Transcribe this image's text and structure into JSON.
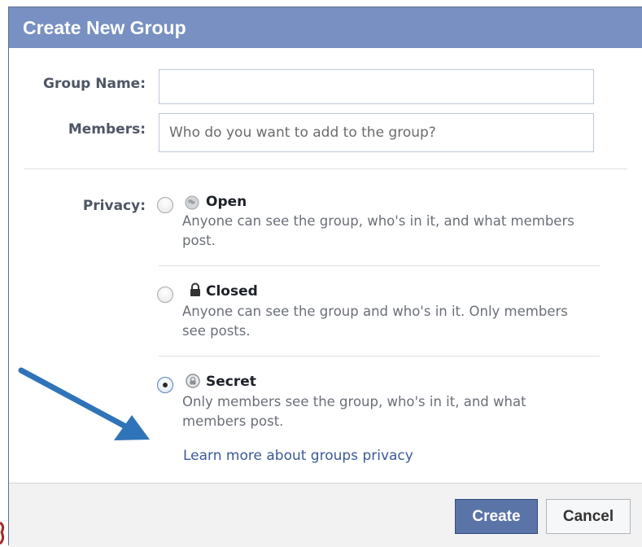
{
  "dialog": {
    "title": "Create New Group",
    "group_name_label": "Group Name:",
    "group_name_value": "",
    "members_label": "Members:",
    "members_placeholder": "Who do you want to add to the group?",
    "privacy_label": "Privacy:",
    "options": [
      {
        "title": "Open",
        "desc": "Anyone can see the group, who's in it, and what members post.",
        "icon": "globe-icon",
        "checked": false
      },
      {
        "title": "Closed",
        "desc": "Anyone can see the group and who's in it. Only members see posts.",
        "icon": "lock-icon",
        "checked": false
      },
      {
        "title": "Secret",
        "desc": "Only members see the group, who's in it, and what members post.",
        "icon": "secret-lock-icon",
        "checked": true
      }
    ],
    "learn_more": "Learn more about groups privacy",
    "create_label": "Create",
    "cancel_label": "Cancel"
  },
  "colors": {
    "titlebar": "#7890c2",
    "primary_button": "#5b74a8",
    "link": "#3b5998",
    "annotation_arrow": "#2f74b8"
  }
}
